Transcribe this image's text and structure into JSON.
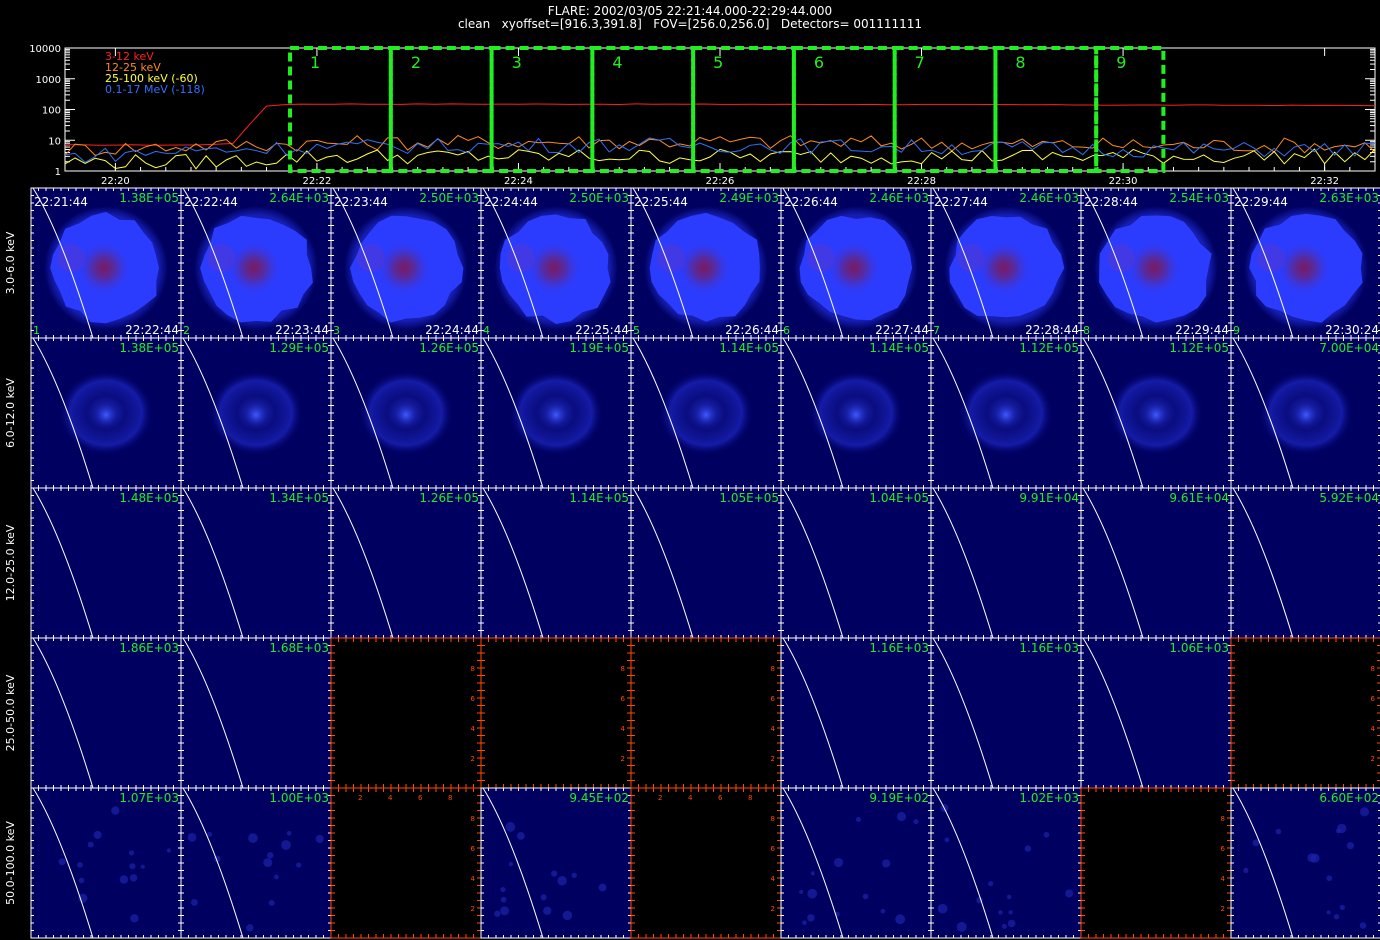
{
  "header": {
    "line1": "FLARE: 2002/03/05 22:21:44.000-22:29:44.000",
    "line2": "clean   xyoffset=[916.3,391.8]   FOV=[256.0,256.0]   Detectors= 001111111"
  },
  "chart_data": [
    {
      "type": "line",
      "title": "",
      "xlabel": "",
      "ylabel": "",
      "y_scale": "log",
      "ylim": [
        1,
        10000
      ],
      "y_tick_labels": [
        "1",
        "10",
        "100",
        "1000",
        "10000"
      ],
      "x_tick_labels": [
        "22:20",
        "22:22",
        "22:24",
        "22:26",
        "22:28",
        "22:30",
        "22:32"
      ],
      "xlim": [
        "22:19:30",
        "22:32:30"
      ],
      "legend_position": "top-left",
      "series": [
        {
          "name": "3-12 keV",
          "color": "#ff2020",
          "x": [
            "22:19:30",
            "22:20:30",
            "22:20:50",
            "22:21:10",
            "22:21:30",
            "22:21:44",
            "22:24",
            "22:26",
            "22:28",
            "22:30",
            "22:32:30"
          ],
          "values": [
            7,
            7,
            7,
            8,
            130,
            150,
            150,
            148,
            145,
            140,
            135
          ]
        },
        {
          "name": "12-25 keV",
          "color": "#ff8c1a",
          "x": [
            "22:19:30",
            "22:21",
            "22:22",
            "22:24",
            "22:26",
            "22:28",
            "22:30",
            "22:32:30"
          ],
          "values": [
            5,
            7,
            8,
            9,
            9,
            8,
            7,
            7
          ]
        },
        {
          "name": "25-100 keV (-60)",
          "color": "#ffff40",
          "x": [
            "22:19:30",
            "22:21",
            "22:22",
            "22:24",
            "22:26",
            "22:28",
            "22:30",
            "22:32:30"
          ],
          "values": [
            2,
            2,
            3,
            3,
            3,
            3,
            3,
            3
          ]
        },
        {
          "name": "0.1-17 MeV (-118)",
          "color": "#3070ff",
          "x": [
            "22:19:30",
            "22:21",
            "22:22",
            "22:24",
            "22:26",
            "22:28",
            "22:30",
            "22:32:30"
          ],
          "values": [
            3,
            5,
            6,
            7,
            7,
            6,
            5,
            5
          ]
        }
      ],
      "intervals": {
        "labels": [
          "1",
          "2",
          "3",
          "4",
          "5",
          "6",
          "7",
          "8",
          "9"
        ],
        "start": [
          "22:21:44",
          "22:22:44",
          "22:23:44",
          "22:24:44",
          "22:25:44",
          "22:26:44",
          "22:27:44",
          "22:28:44",
          "22:29:44"
        ],
        "color": "#22ee22"
      }
    },
    {
      "type": "heatmap",
      "rows": [
        "3.0-6.0 keV",
        "6.0-12.0 keV",
        "12.0-25.0 keV",
        "25.0-50.0 keV",
        "50.0-100.0 keV"
      ],
      "columns": [
        "1",
        "2",
        "3",
        "4",
        "5",
        "6",
        "7",
        "8",
        "9"
      ],
      "start_times": [
        "22:21:44",
        "22:22:44",
        "22:23:44",
        "22:24:44",
        "22:25:44",
        "22:26:44",
        "22:27:44",
        "22:28:44",
        "22:29:44"
      ],
      "end_times": [
        "22:22:44",
        "22:23:44",
        "22:24:44",
        "22:25:44",
        "22:26:44",
        "22:27:44",
        "22:28:44",
        "22:29:44",
        "22:30:24"
      ],
      "max_values": [
        [
          "1.38E+05",
          "2.64E+03",
          "2.50E+03",
          "2.50E+03",
          "2.49E+03",
          "2.46E+03",
          "2.46E+03",
          "2.54E+03",
          "2.63E+03"
        ],
        [
          "1.38E+05",
          "1.29E+05",
          "1.26E+05",
          "1.19E+05",
          "1.14E+05",
          "1.14E+05",
          "1.12E+05",
          "1.12E+05",
          "7.00E+04"
        ],
        [
          "1.48E+05",
          "1.34E+05",
          "1.26E+05",
          "1.14E+05",
          "1.05E+05",
          "1.04E+05",
          "9.91E+04",
          "9.61E+04",
          "5.92E+04"
        ],
        [
          "1.86E+03",
          "1.68E+03",
          "",
          "",
          "",
          "1.16E+03",
          "1.16E+03",
          "1.06E+03",
          ""
        ],
        [
          "1.07E+03",
          "1.00E+03",
          "",
          "9.45E+02",
          "",
          "9.19E+02",
          "1.02E+03",
          "",
          "6.60E+02"
        ]
      ],
      "panel_types": [
        [
          "disk",
          "disk",
          "disk",
          "disk",
          "disk",
          "disk",
          "disk",
          "disk",
          "disk"
        ],
        [
          "ring",
          "ring",
          "ring",
          "ring",
          "ring",
          "ring",
          "ring",
          "ring",
          "ring"
        ],
        [
          "empty",
          "empty",
          "empty",
          "empty",
          "empty",
          "empty",
          "empty",
          "empty",
          "empty"
        ],
        [
          "empty",
          "empty",
          "blank",
          "blank",
          "blank",
          "empty",
          "empty",
          "empty",
          "blank"
        ],
        [
          "empty",
          "empty",
          "blank",
          "empty",
          "blank",
          "empty",
          "empty",
          "blank",
          "empty"
        ]
      ],
      "blank_axis_ticks": [
        "2",
        "4",
        "6",
        "8"
      ],
      "colors": {
        "max_label": "#22ee22",
        "panel_bg": "#000060",
        "disk": "#2b3cff",
        "core": "#7a1a60",
        "limb": "#ffffff",
        "blank_axes": "#ff4a00"
      }
    }
  ]
}
